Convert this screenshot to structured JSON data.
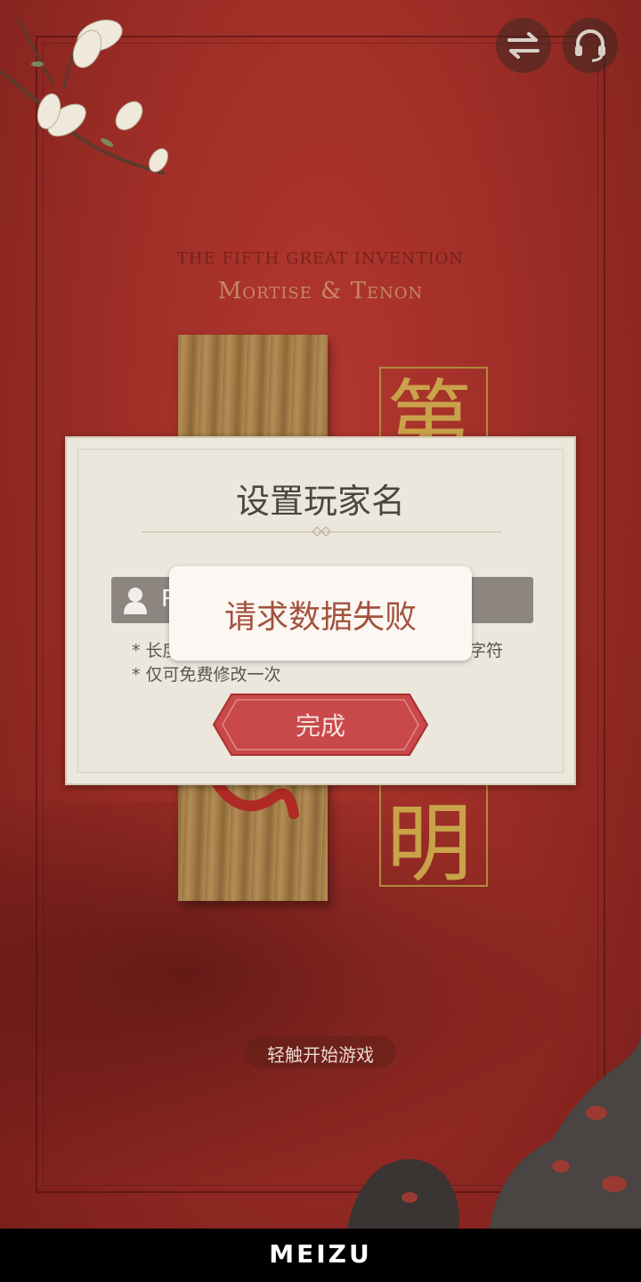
{
  "header": {
    "subtitle_top": "THE FIFTH GREAT INVENTION",
    "subtitle_bottom": "Mortise & Tenon"
  },
  "calligraphy": {
    "top_char": "第",
    "bottom_char": "明"
  },
  "dialog": {
    "title": "设置玩家名",
    "input_value": "R",
    "hint1_start": "* 长度",
    "hint1_end": "字符",
    "hint2": "* 仅可免费修改一次",
    "done_label": "完成"
  },
  "toast": {
    "message": "请求数据失败"
  },
  "tap_start": "轻触开始游戏",
  "navbar": {
    "brand": "MEIZU"
  },
  "icons": {
    "switch": "switch-arrows-icon",
    "support": "headset-icon",
    "user": "user-icon"
  },
  "colors": {
    "background": "#a3312a",
    "dialog": "#ece7dd",
    "button": "#c9484a",
    "toast_text": "#a2533f",
    "gold": "#c9a24a"
  }
}
